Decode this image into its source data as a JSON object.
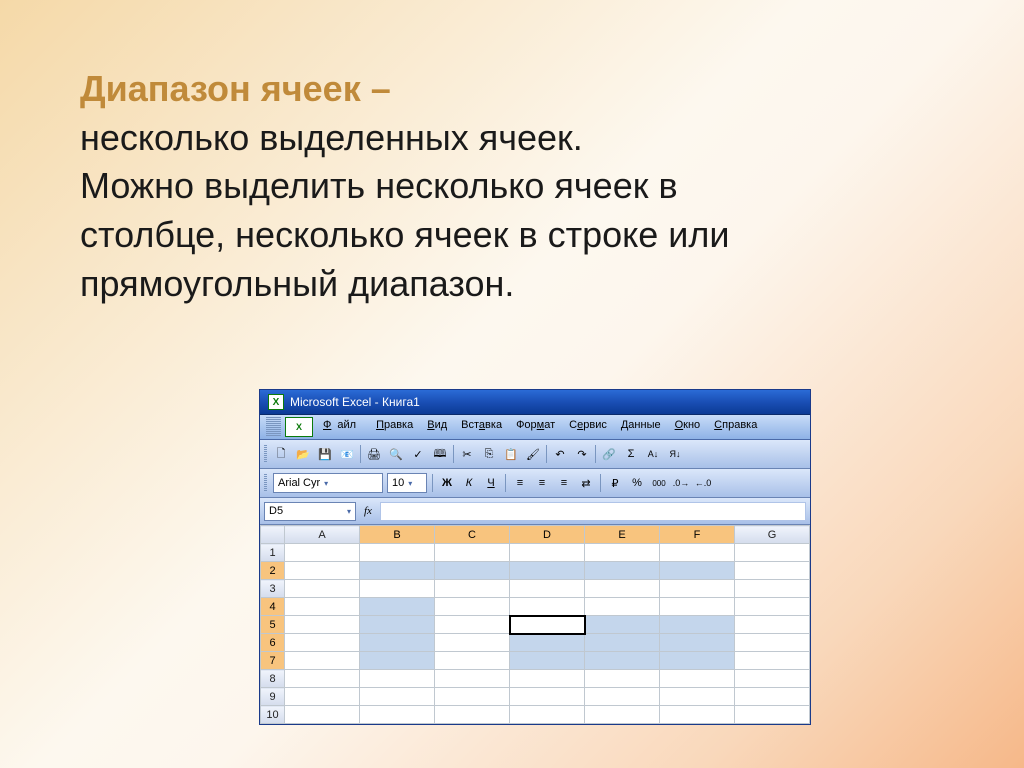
{
  "slide": {
    "title": "Диапазон ячеек –",
    "line1": "несколько выделенных ячеек.",
    "line2": "Можно выделить несколько ячеек в",
    "line3": "столбце, несколько ячеек в строке или",
    "line4": "прямоугольный диапазон."
  },
  "excel": {
    "window_title": "Microsoft Excel - Книга1",
    "menu": {
      "file": "Файл",
      "edit": "Правка",
      "view": "Вид",
      "insert": "Вставка",
      "format": "Формат",
      "tools": "Сервис",
      "data": "Данные",
      "window": "Окно",
      "help": "Справка"
    },
    "fmt": {
      "font": "Arial Cyr",
      "size": "10",
      "bold": "Ж",
      "italic": "К",
      "underline": "Ч",
      "currency": "%",
      "pct": "%",
      "th": "000"
    },
    "ref": {
      "cell": "D5",
      "fx": "fx"
    },
    "cols": [
      "A",
      "B",
      "C",
      "D",
      "E",
      "F",
      "G"
    ],
    "rows": [
      "1",
      "2",
      "3",
      "4",
      "5",
      "6",
      "7",
      "8",
      "9",
      "10"
    ]
  }
}
